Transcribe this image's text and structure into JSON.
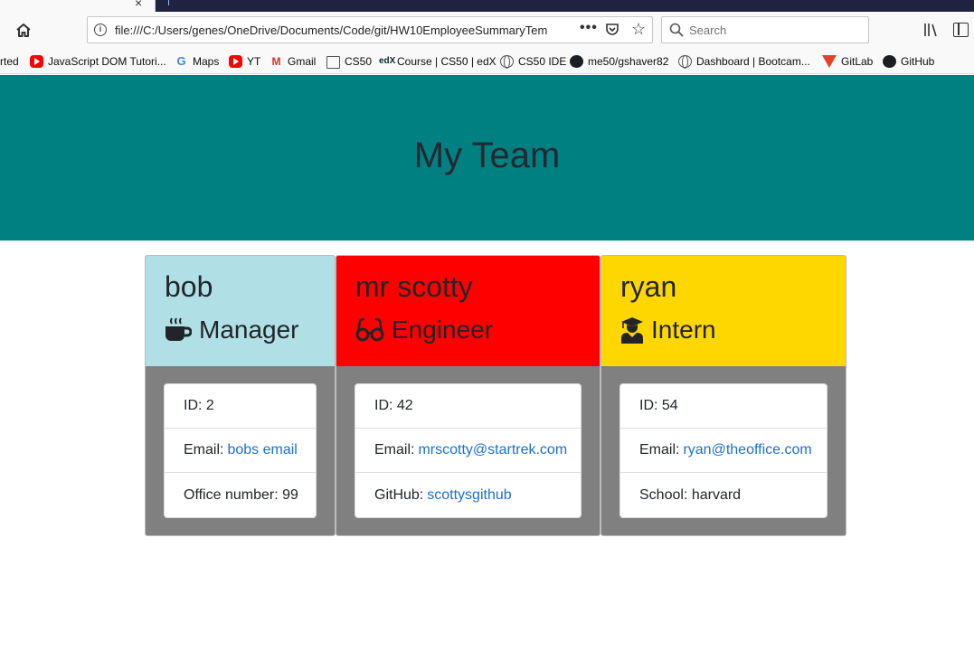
{
  "browser": {
    "url": "file:///C:/Users/genes/OneDrive/Documents/Code/git/HW10EmployeeSummaryTem",
    "more_label": "•••",
    "search_placeholder": "Search",
    "bookmarks": [
      {
        "label": "rted",
        "icon": "none"
      },
      {
        "label": "JavaScript DOM Tutori...",
        "icon": "youtube-icon"
      },
      {
        "label": "Maps",
        "icon": "google-icon"
      },
      {
        "label": "YT",
        "icon": "youtube-icon"
      },
      {
        "label": "Gmail",
        "icon": "gmail-icon"
      },
      {
        "label": "CS50",
        "icon": "folder-icon"
      },
      {
        "label": "Course | CS50 | edX",
        "icon": "edx-icon"
      },
      {
        "label": "CS50 IDE",
        "icon": "globe-icon"
      },
      {
        "label": "me50/gshaver82",
        "icon": "github-icon"
      },
      {
        "label": "Dashboard | Bootcam...",
        "icon": "globe-icon"
      },
      {
        "label": "GitLab",
        "icon": "gitlab-icon"
      },
      {
        "label": "GitHub",
        "icon": "github-icon"
      }
    ]
  },
  "page": {
    "title": "My Team"
  },
  "team": [
    {
      "name": "bob",
      "role": "Manager",
      "role_icon": "coffee-mug-icon",
      "header_color": "#b0e0e6",
      "id_label": "ID:",
      "id": "2",
      "email_label": "Email:",
      "email": "bobs email",
      "extra_label": "Office number:",
      "extra": "99"
    },
    {
      "name": "mr scotty",
      "role": "Engineer",
      "role_icon": "glasses-icon",
      "header_color": "#ff0000",
      "id_label": "ID:",
      "id": "42",
      "email_label": "Email:",
      "email": "mrscotty@startrek.com",
      "extra_label": "GitHub:",
      "extra": "scottysgithub"
    },
    {
      "name": "ryan",
      "role": "Intern",
      "role_icon": "graduate-icon",
      "header_color": "#ffd700",
      "id_label": "ID:",
      "id": "54",
      "email_label": "Email:",
      "email": "ryan@theoffice.com",
      "extra_label": "School:",
      "extra": "harvard"
    }
  ],
  "colors": {
    "jumbotron": "#008080",
    "card_body": "#808080",
    "link": "#1a6fd4"
  }
}
